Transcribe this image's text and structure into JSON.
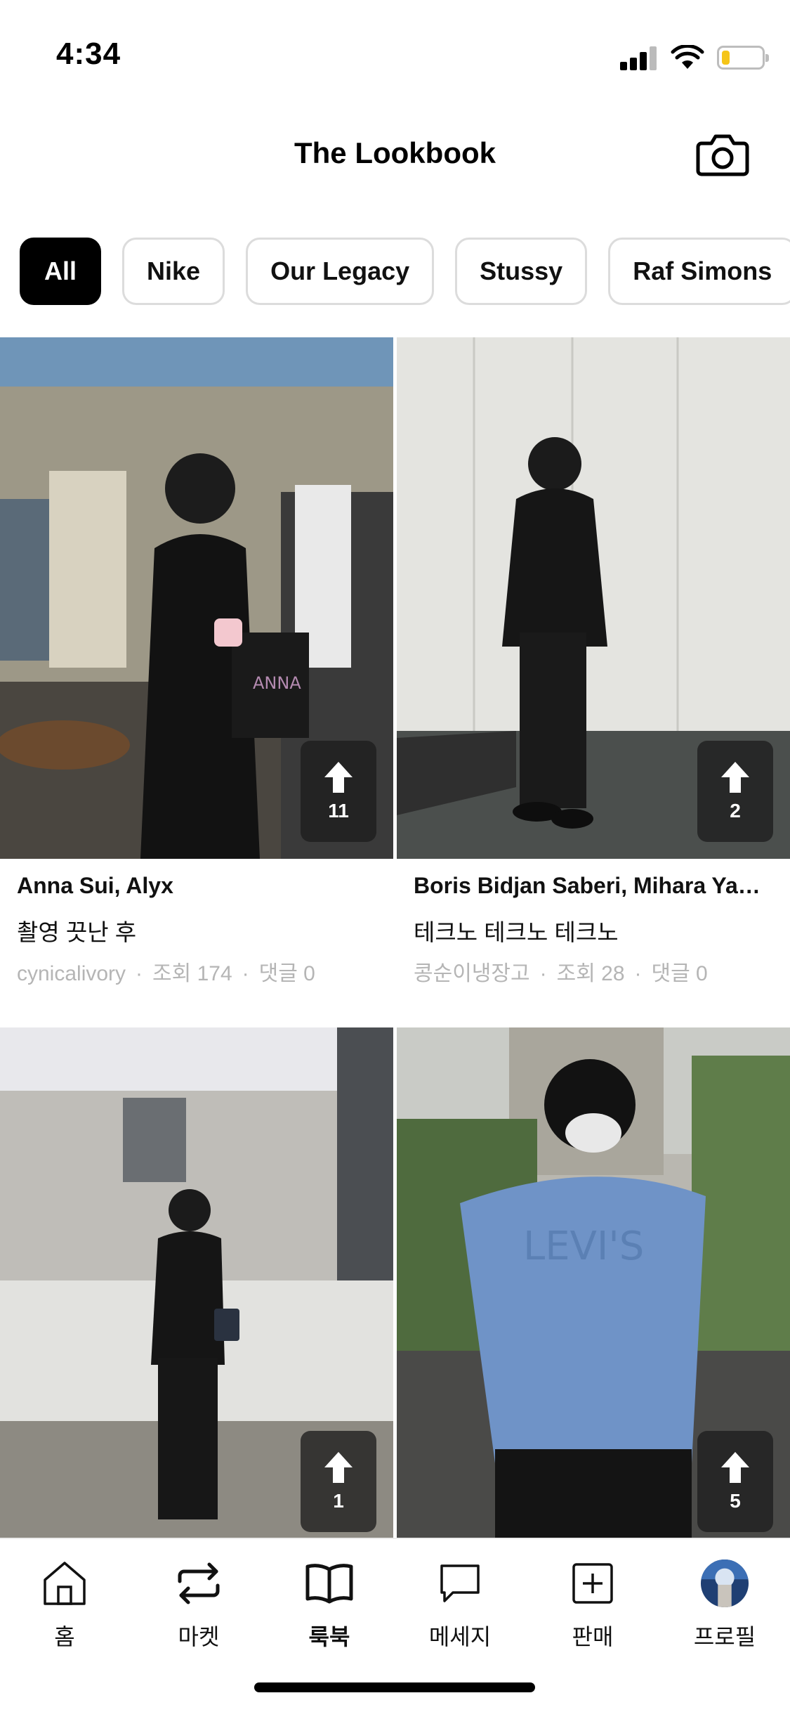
{
  "status_bar": {
    "time": "4:34",
    "battery_level": 0.2,
    "battery_color": "#f5c518"
  },
  "header": {
    "title": "The Lookbook",
    "camera_icon": "camera-icon"
  },
  "filters": {
    "active_index": 0,
    "chips": [
      "All",
      "Nike",
      "Our Legacy",
      "Stussy",
      "Raf Simons"
    ]
  },
  "posts": [
    {
      "brands": "Anna Sui, Alyx",
      "title": "촬영 끗난 후",
      "author": "cynicalivory",
      "views": "조회 174",
      "comments": "댓글 0",
      "upvotes": "11"
    },
    {
      "brands": "Boris Bidjan Saberi, Mihara Ya…",
      "title": "테크노 테크노 테크노",
      "author": "콩순이냉장고",
      "views": "조회 28",
      "comments": "댓글 0",
      "upvotes": "2"
    },
    {
      "upvotes": "1"
    },
    {
      "upvotes": "5"
    }
  ],
  "tabbar": {
    "active": "lookbook",
    "tabs": [
      {
        "key": "home",
        "label": "홈",
        "icon": "home-icon"
      },
      {
        "key": "market",
        "label": "마켓",
        "icon": "swap-arrows-icon"
      },
      {
        "key": "lookbook",
        "label": "룩북",
        "icon": "open-book-icon"
      },
      {
        "key": "messages",
        "label": "메세지",
        "icon": "chat-bubble-icon"
      },
      {
        "key": "sell",
        "label": "판매",
        "icon": "plus-square-icon"
      },
      {
        "key": "profile",
        "label": "프로필",
        "icon": "avatar"
      }
    ]
  },
  "meta_separator": "·"
}
